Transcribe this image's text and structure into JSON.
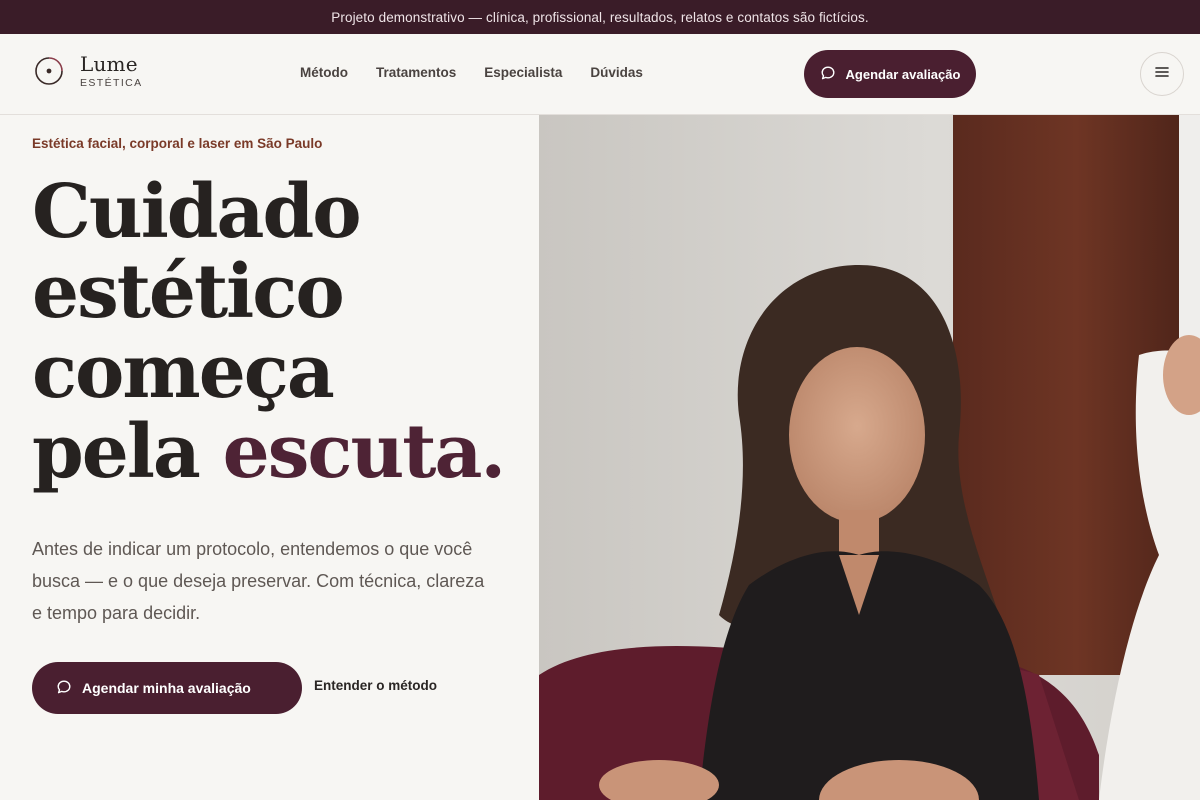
{
  "topbar": {
    "text": "Projeto demonstrativo — clínica, profissional, resultados, relatos e contatos são fictícios."
  },
  "brand": {
    "name": "Lume",
    "tagline": "ESTÉTICA"
  },
  "nav": {
    "items": [
      "Método",
      "Tratamentos",
      "Especialista",
      "Dúvidas"
    ]
  },
  "header": {
    "cta_label": "Agendar avaliação"
  },
  "hero": {
    "eyebrow": "Estética facial, corporal e laser em São Paulo",
    "headline_line1": "Cuidado",
    "headline_line2": "estético",
    "headline_line3": "começa",
    "headline_line4_plain": "pela ",
    "headline_line4_accent": "escuta.",
    "lead": "Antes de indicar um protocolo, entendemos o que você busca — e o que deseja preservar. Com técnica, clareza e tempo para decidir.",
    "primary_button": "Agendar minha avaliação",
    "secondary_link": "Entender o método"
  },
  "colors": {
    "brand": "#4a1f30",
    "topbar": "#3a1c28",
    "eyebrow": "#7a3a28",
    "background": "#f7f6f3"
  },
  "icons": {
    "logo": "circle-logo-icon",
    "cta": "chat-bubble-icon",
    "menu": "hamburger-menu-icon",
    "hero_button": "chat-bubble-icon"
  }
}
